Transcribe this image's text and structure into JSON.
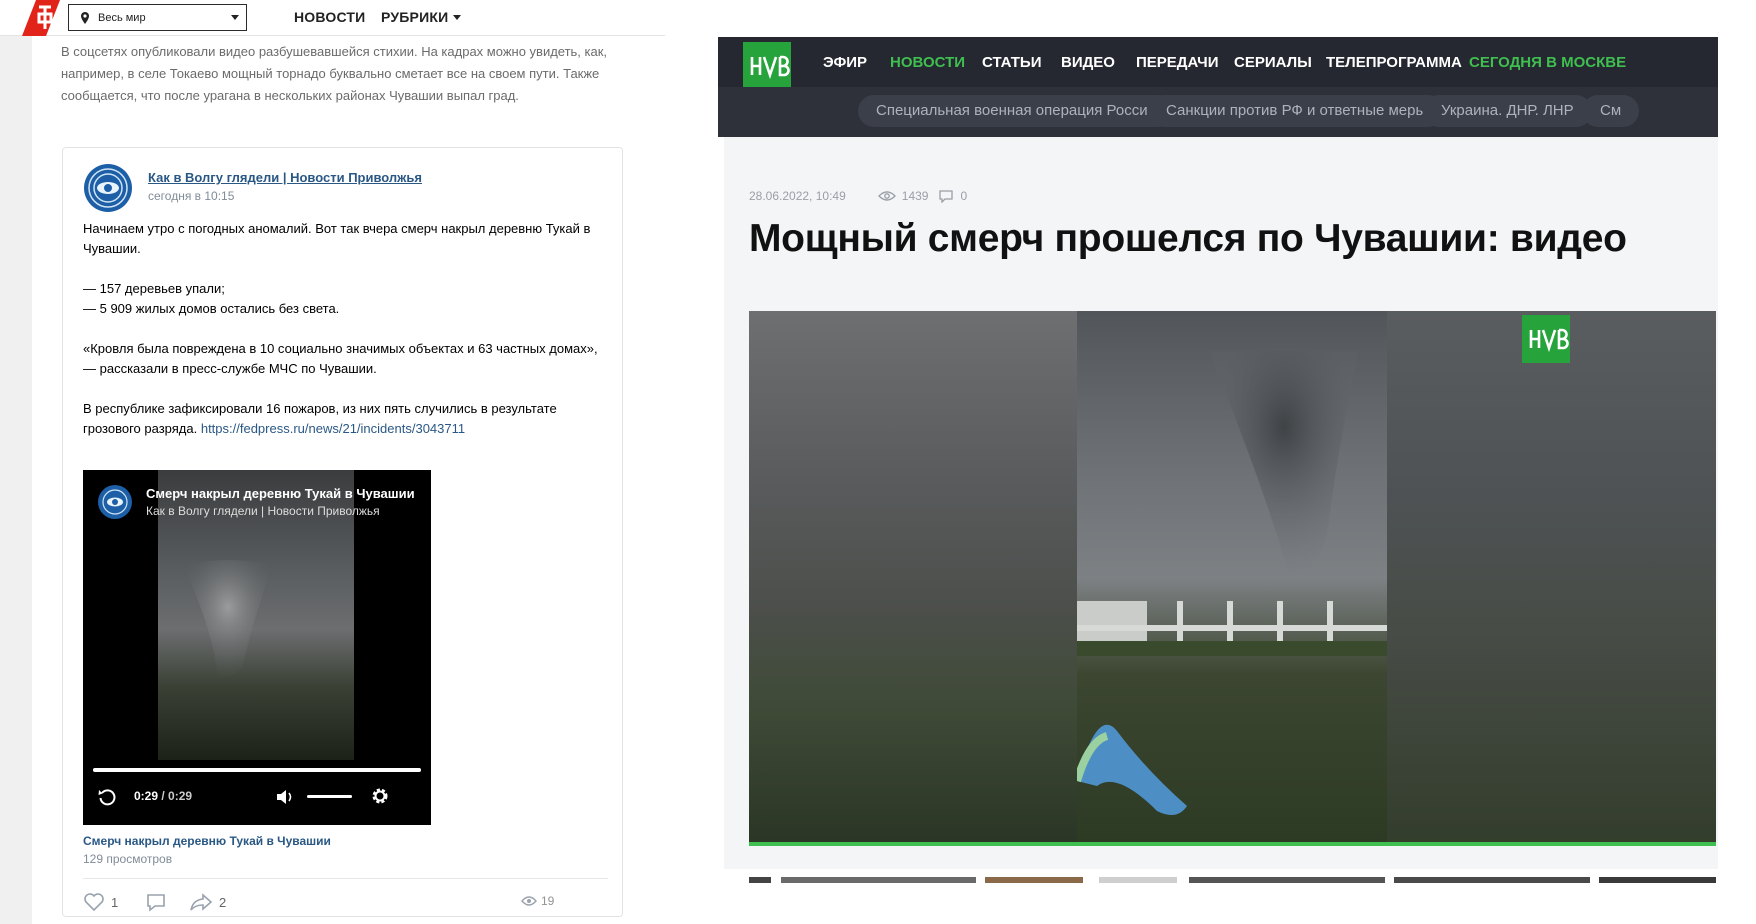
{
  "left": {
    "region_select": {
      "value": "Весь мир"
    },
    "nav": {
      "news": "НОВОСТИ",
      "rubrics": "РУБРИКИ"
    },
    "article_text": "В соцсетях опубликовали видео разбушевавшейся стихии. На кадрах можно увидеть, как, например, в селе Токаево мощный торнадо буквально сметает все на своем пути. Также сообщается, что после урагана в нескольких районах Чувашии выпал град.",
    "vk_post": {
      "author": "Как в Волгу глядели | Новости Приволжья",
      "time": "сегодня в 10:15",
      "paragraph1": "Начинаем утро с погодных аномалий. Вот так вчера смерч накрыл деревню Тукай в Чувашии.",
      "bullet1": "— 157 деревьев упали;",
      "bullet2": "— 5 909 жилых домов остались без света.",
      "paragraph3": "«Кровля была повреждена в 10 социально значимых объектах и 63 частных домах», — рассказали в пресс-службе МЧС по Чувашии.",
      "paragraph4": "В республике зафиксировали 16 пожаров, из них пять случились в результате грозового разряда.",
      "link": "https://fedpress.ru/news/21/incidents/3043711",
      "video": {
        "title": "Смерч накрыл деревню Тукай в Чувашии",
        "channel": "Как в Волгу глядели | Новости Приволжья",
        "current_time": "0:29",
        "duration": "/ 0:29",
        "progress": 1.0,
        "volume": 1.0
      },
      "video_caption": "Смерч накрыл деревню Тукай в Чувашии",
      "video_views": "129 просмотров",
      "likes": "1",
      "shares": "2",
      "views": "19"
    }
  },
  "right": {
    "nav": {
      "efir": "ЭФИР",
      "news": "НОВОСТИ",
      "articles": "СТАТЬИ",
      "video": "ВИДЕО",
      "shows": "ПЕРЕДАЧИ",
      "series": "СЕРИАЛЫ",
      "tvguide": "ТЕЛЕПРОГРАММА",
      "moscow": "СЕГОДНЯ В МОСКВЕ"
    },
    "tags": {
      "tag1": "Специальная военная операция России",
      "tag2": "Санкции против РФ и ответные меры",
      "tag3": "Украина. ДНР. ЛНР",
      "tag4": "См"
    },
    "article": {
      "date": "28.06.2022, 10:49",
      "views": "1439",
      "comments": "0",
      "title": "Мощный смерч прошелся по Чувашии: видео"
    },
    "colors": {
      "header_bg": "#252830",
      "accent_green": "#3fbf4f",
      "logo_green": "#26a33b"
    }
  }
}
